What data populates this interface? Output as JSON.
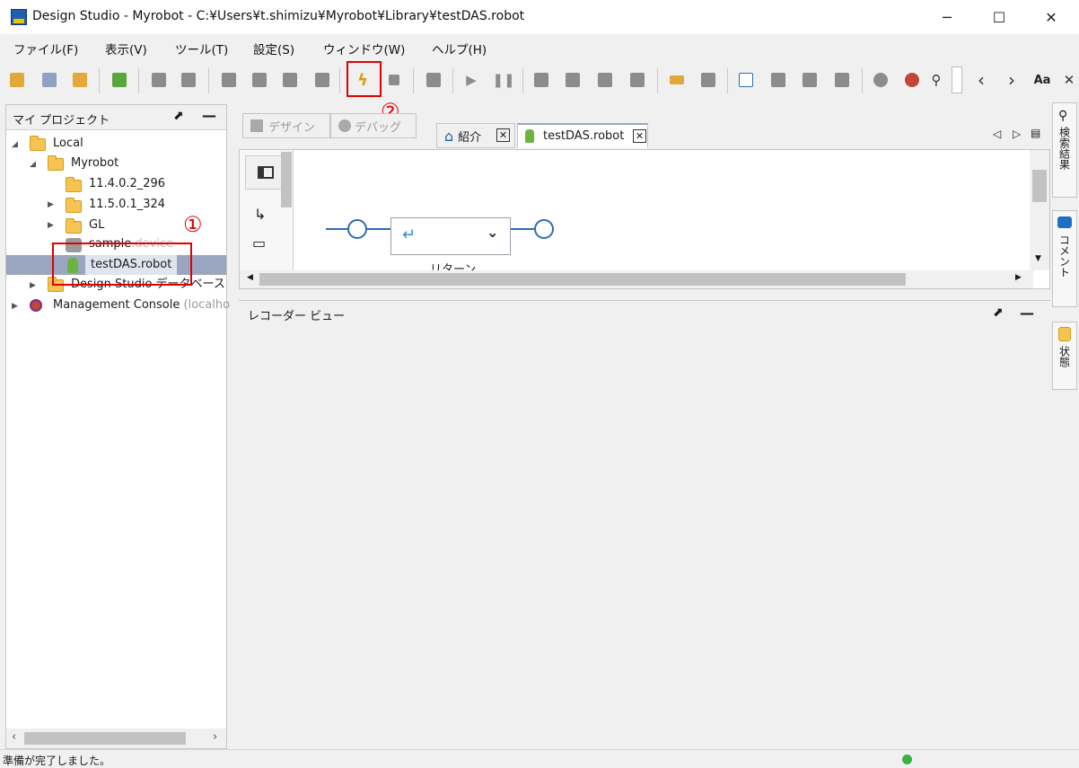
{
  "window": {
    "title": "Design Studio - Myrobot - C:¥Users¥t.shimizu¥Myrobot¥Library¥testDAS.robot",
    "minimize_glyph": "─",
    "maximize_glyph": "☐",
    "close_glyph": "✕"
  },
  "menu": [
    "ファイル(F)",
    "表示(V)",
    "ツール(T)",
    "設定(S)",
    "ウィンドウ(W)",
    "ヘルプ(H)"
  ],
  "toolbar": {
    "icons": [
      "open-icon",
      "save-all-icon",
      "refresh-icon",
      "add-robot-icon",
      "undo-icon",
      "redo-icon",
      "copy-icon",
      "cut-icon",
      "paste-icon",
      "delete-icon",
      "debug-bolt-icon",
      "stop-icon",
      "step-icon",
      "run-icon",
      "pause-icon",
      "step-a-icon",
      "step-b-icon",
      "step-c-icon",
      "step-d-icon",
      "tag-icon",
      "select-icon",
      "add-node-icon",
      "remove-node-icon",
      "node-a-icon",
      "node-b-icon",
      "browse-icon",
      "world-icon",
      "search-icon"
    ],
    "prev_glyph": "‹",
    "next_glyph": "›",
    "font_button": "Aa"
  },
  "left_panel": {
    "title": "マイ プロジェクト",
    "tree": [
      {
        "label": "Local",
        "sub": ""
      },
      {
        "label": "Myrobot",
        "sub": ""
      },
      {
        "label": "11.4.0.2_296",
        "sub": ""
      },
      {
        "label": "11.5.0.1_324",
        "sub": ""
      },
      {
        "label": "GL",
        "sub": ""
      },
      {
        "label": "sample",
        "sub": ".device"
      },
      {
        "label": "testDAS.robot",
        "sub": ""
      },
      {
        "label": "Design Studio データベース",
        "sub": ""
      },
      {
        "label": "Management Console",
        "sub": "(localho"
      }
    ]
  },
  "editor": {
    "mode_tabs": [
      "デザイン",
      "デバッグ"
    ],
    "tabs": [
      "紹介",
      "testDAS.robot"
    ],
    "step_label": "リターン",
    "return_glyph": "↵",
    "dropdown_glyph": "⌄"
  },
  "recorder": {
    "title": "レコーダー ビュー"
  },
  "right_tabs": [
    "検索結果",
    "コメント",
    "状態"
  ],
  "annotations": {
    "one": "①",
    "two": "②"
  },
  "status": {
    "text": "準備が完了しました。",
    "indicator_color": "#3cb043"
  },
  "colors": {
    "highlight": "#e00000",
    "selection": "#9aa6bf",
    "flow_line": "#2b6cb5"
  }
}
